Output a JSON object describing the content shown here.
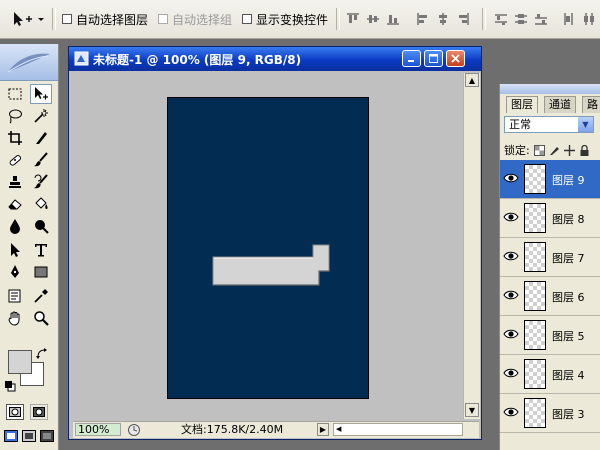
{
  "options_bar": {
    "auto_select_layer": "自动选择图层",
    "auto_select_group": "自动选择组",
    "show_transform_controls": "显示变换控件"
  },
  "document": {
    "title": "未标题-1 @ 100% (图层 9, RGB/8)",
    "canvas_color": "#032c52",
    "shape_color": "#d4d4d4",
    "zoom": "100%",
    "doc_info": "文档:175.8K/2.40M"
  },
  "layers_panel": {
    "tabs": [
      "图层",
      "通道",
      "路"
    ],
    "blend_mode": "正常",
    "lock_label": "锁定:",
    "layers": [
      {
        "name": "图层 9",
        "selected": true
      },
      {
        "name": "图层 8",
        "selected": false
      },
      {
        "name": "图层 7",
        "selected": false
      },
      {
        "name": "图层 6",
        "selected": false
      },
      {
        "name": "图层 5",
        "selected": false
      },
      {
        "name": "图层 4",
        "selected": false
      },
      {
        "name": "图层 3",
        "selected": false
      }
    ]
  },
  "tools": [
    "marquee-tool-icon",
    "move-tool-icon",
    "lasso-tool-icon",
    "magic-wand-tool-icon",
    "crop-tool-icon",
    "slice-tool-icon",
    "healing-brush-tool-icon",
    "brush-tool-icon",
    "clone-stamp-tool-icon",
    "history-brush-tool-icon",
    "eraser-tool-icon",
    "paint-bucket-tool-icon",
    "blur-tool-icon",
    "burn-tool-icon",
    "path-select-tool-icon",
    "type-tool-icon",
    "pen-tool-icon",
    "rectangle-tool-icon",
    "notes-tool-icon",
    "eyedropper-tool-icon",
    "hand-tool-icon",
    "zoom-tool-icon"
  ]
}
